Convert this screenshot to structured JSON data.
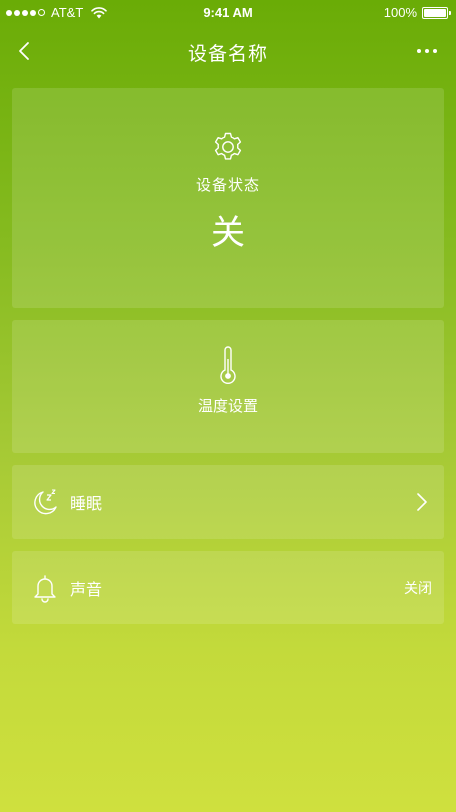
{
  "status_bar": {
    "carrier": "AT&T",
    "time": "9:41 AM",
    "battery": "100%"
  },
  "nav": {
    "title": "设备名称",
    "back_icon": "chevron-left-icon",
    "more_icon": "more-horizontal-icon"
  },
  "device_status": {
    "icon": "gear-icon",
    "label": "设备状态",
    "value": "关"
  },
  "temperature": {
    "icon": "thermometer-icon",
    "label": "温度设置"
  },
  "sleep": {
    "icon": "moon-zzz-icon",
    "label": "睡眠",
    "arrow_icon": "chevron-right-icon"
  },
  "sound": {
    "icon": "bell-icon",
    "label": "声音",
    "value": "关闭"
  },
  "colors": {
    "gradient_top": "#6aac06",
    "gradient_bottom": "#cfe03e",
    "text": "#ffffff"
  }
}
